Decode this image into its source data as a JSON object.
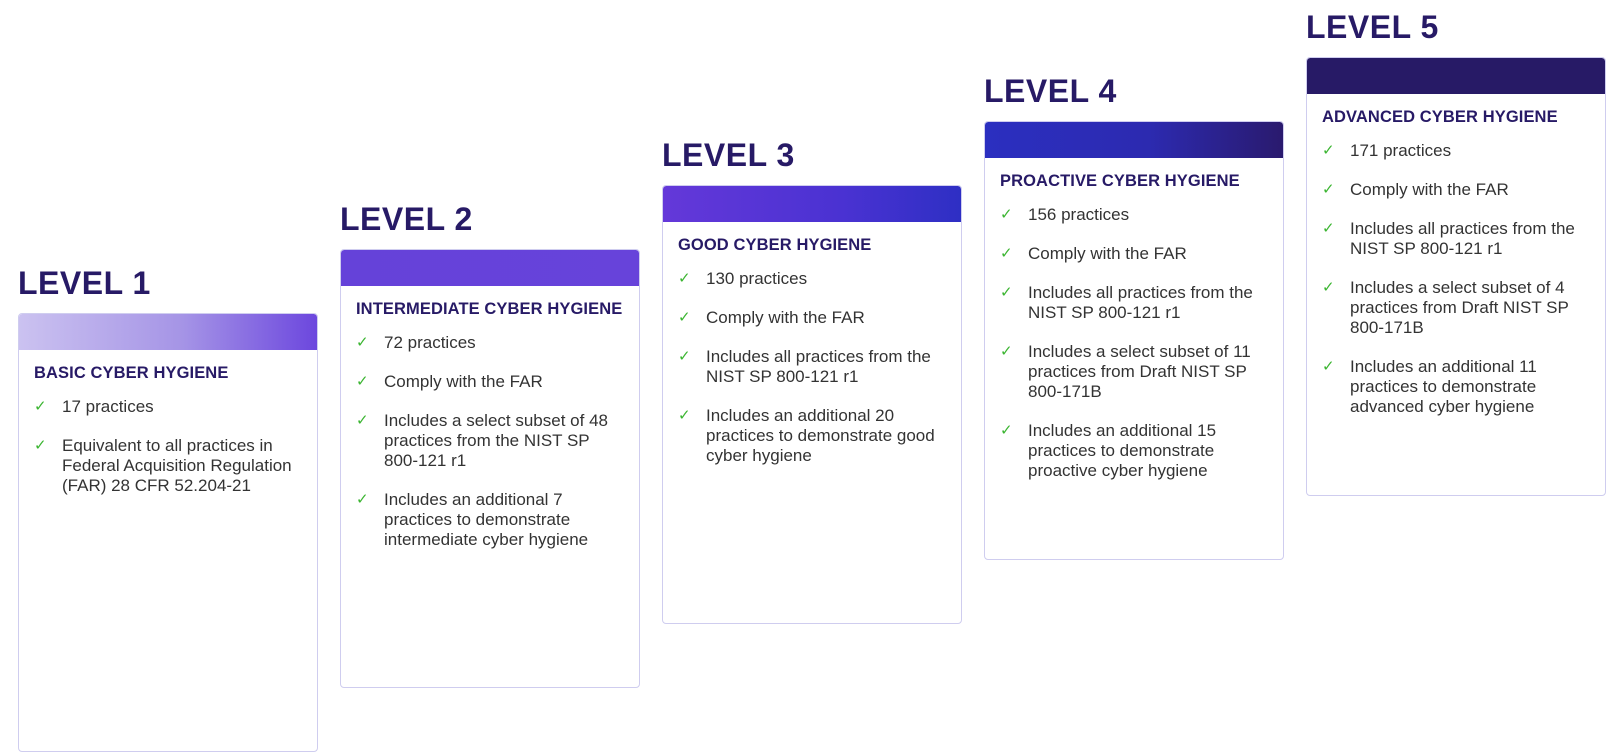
{
  "levels": [
    {
      "title": "LEVEL 1",
      "heading": "BASIC CYBER HYGIENE",
      "items": [
        "17 practices",
        "Equivalent to all practices in Federal Acquisition Regulation (FAR) 28 CFR 52.204-21"
      ]
    },
    {
      "title": "LEVEL 2",
      "heading": "INTERMEDIATE CYBER HYGIENE",
      "items": [
        "72 practices",
        "Comply with the FAR",
        "Includes a select subset of 48 practices from the NIST SP 800-121 r1",
        "Includes an additional 7 practices to demonstrate intermediate cyber hygiene"
      ]
    },
    {
      "title": "LEVEL 3",
      "heading": "GOOD CYBER HYGIENE",
      "items": [
        "130 practices",
        "Comply with the FAR",
        "Includes all practices from the NIST SP 800-121 r1",
        "Includes an additional 20 practices to demonstrate good cyber hygiene"
      ]
    },
    {
      "title": "LEVEL 4",
      "heading": "PROACTIVE CYBER HYGIENE",
      "items": [
        "156 practices",
        "Comply with the FAR",
        "Includes all practices from the NIST SP 800-121 r1",
        "Includes a select subset of 11 practices from Draft NIST SP 800-171B",
        "Includes an additional 15 practices to demonstrate proactive cyber hygiene"
      ]
    },
    {
      "title": "LEVEL 5",
      "heading": "ADVANCED CYBER HYGIENE",
      "items": [
        "171 practices",
        "Comply with the FAR",
        "Includes all practices from the NIST SP 800-121 r1",
        "Includes a select subset of 4 practices from Draft NIST SP 800-171B",
        "Includes an additional 11 practices to demonstrate advanced cyber hygiene"
      ]
    }
  ],
  "icons": {
    "check": "✓"
  },
  "colors": {
    "title": "#271a66",
    "check": "#3cb532",
    "text": "#333333",
    "border": "#cfcdef"
  }
}
